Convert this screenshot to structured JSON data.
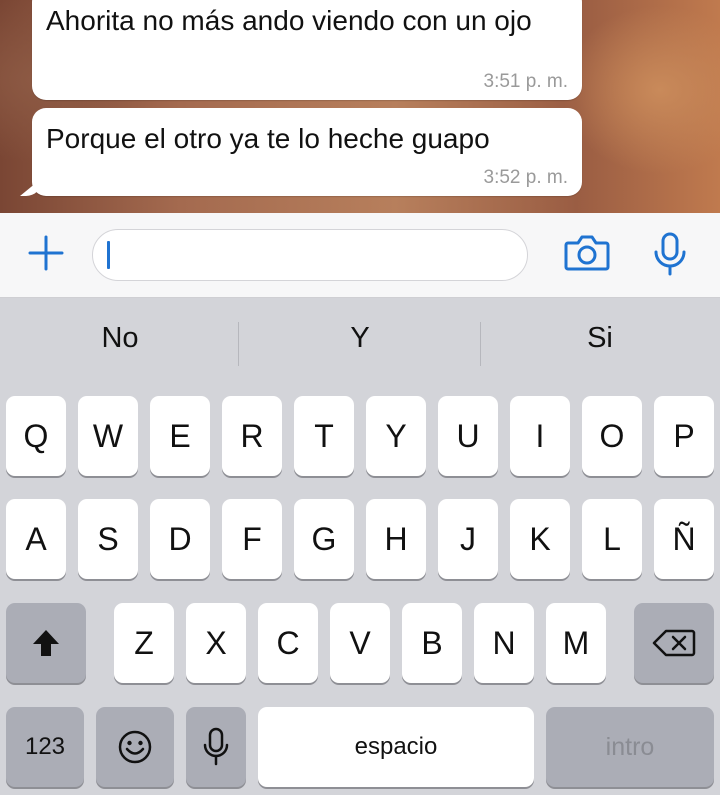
{
  "messages": [
    {
      "text": "Ahorita no más ando viendo con un ojo",
      "time": "3:51 p. m."
    },
    {
      "text": "Porque el otro ya te lo heche guapo",
      "time": "3:52 p. m."
    }
  ],
  "input": {
    "value": ""
  },
  "icons": {
    "plus": "plus-icon",
    "camera": "camera-icon",
    "mic": "microphone-icon"
  },
  "colors": {
    "accent": "#1f73d1",
    "bubble": "#ffffff",
    "keyboard_bg": "#d3d4d9",
    "dark_key": "#abadb6"
  },
  "suggestions": [
    "No",
    "Y",
    "Si"
  ],
  "keyboard": {
    "row1": [
      "Q",
      "W",
      "E",
      "R",
      "T",
      "Y",
      "U",
      "I",
      "O",
      "P"
    ],
    "row2": [
      "A",
      "S",
      "D",
      "F",
      "G",
      "H",
      "J",
      "K",
      "L",
      "Ñ"
    ],
    "row3": [
      "Z",
      "X",
      "C",
      "V",
      "B",
      "N",
      "M"
    ],
    "numbers_label": "123",
    "space_label": "espacio",
    "return_label": "intro"
  }
}
